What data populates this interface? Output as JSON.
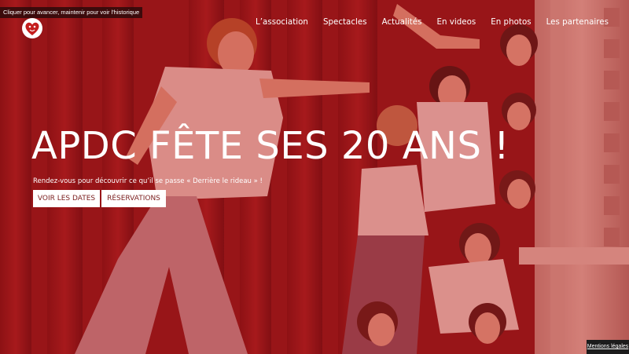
{
  "tooltip": {
    "text": "Cliquer pour avancer, maintenir pour voir l'historique"
  },
  "logo": {
    "icon": "heart-mask-icon",
    "color": "#c41e1e"
  },
  "nav": {
    "items": [
      {
        "label": "L’association"
      },
      {
        "label": "Spectacles"
      },
      {
        "label": "Actualités"
      },
      {
        "label": "En videos"
      },
      {
        "label": "En photos"
      },
      {
        "label": "Les partenaires"
      }
    ]
  },
  "hero": {
    "title": "APDC FÊTE SES 20 ANS !",
    "subtitle": "Rendez-vous pour découvrir ce qu’il se passe « Derrière le rideau » !",
    "overlay_color": "#b11a1a",
    "buttons": {
      "dates_label": "VOIR LES DATES",
      "reservations_label": "RÉSERVATIONS"
    }
  },
  "footer": {
    "legal_label": "Mentions légales"
  }
}
